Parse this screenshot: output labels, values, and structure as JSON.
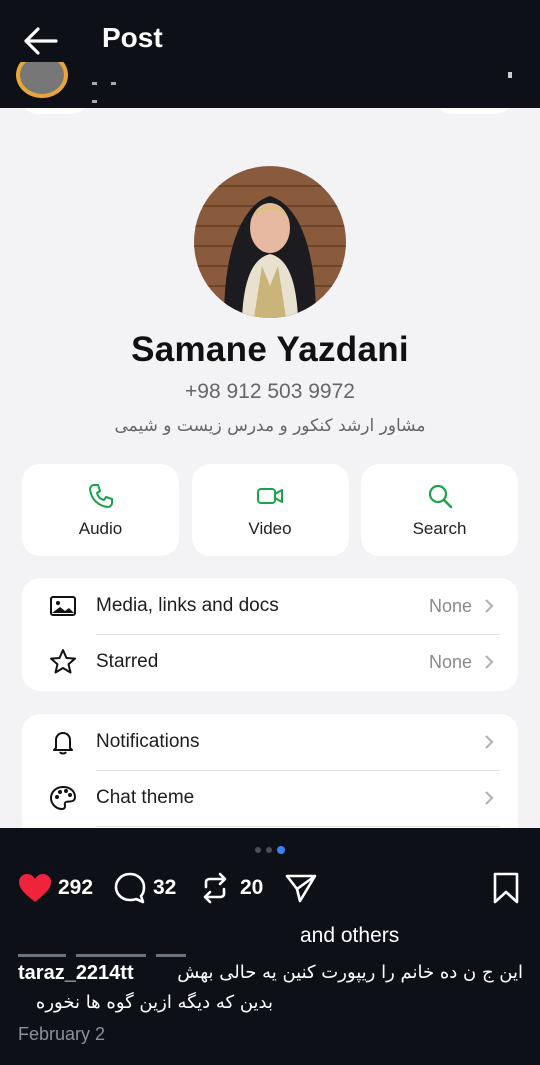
{
  "topbar": {
    "title": "Post"
  },
  "profile": {
    "name": "Samane Yazdani",
    "phone": "+98 912 503 9972",
    "bio": "مشاور ارشد کنکور و مدرس زیست و شیمی"
  },
  "actions": [
    {
      "label": "Audio",
      "icon": "phone-icon"
    },
    {
      "label": "Video",
      "icon": "video-icon"
    },
    {
      "label": "Search",
      "icon": "search-icon"
    }
  ],
  "card1": [
    {
      "label": "Media, links and docs",
      "value": "None",
      "icon": "image-icon"
    },
    {
      "label": "Starred",
      "value": "None",
      "icon": "star-icon"
    }
  ],
  "card2": [
    {
      "label": "Notifications",
      "icon": "bell-icon"
    },
    {
      "label": "Chat theme",
      "icon": "palette-icon"
    }
  ],
  "pager": {
    "count": 3,
    "active": 2
  },
  "stats": {
    "likes": "292",
    "comments": "32",
    "reposts": "20"
  },
  "others_text": "and others",
  "caption": {
    "username": "taraz_2214tt",
    "line1": "این ج ن ده خانم را ریپورت کنین یه حالی بهش",
    "line2": "بدین که دیگه ازین گوه ها نخوره"
  },
  "date": "February 2",
  "colors": {
    "like": "#ef233c",
    "whatsapp_green": "#1aa34a",
    "pager_active": "#3b82f6"
  }
}
